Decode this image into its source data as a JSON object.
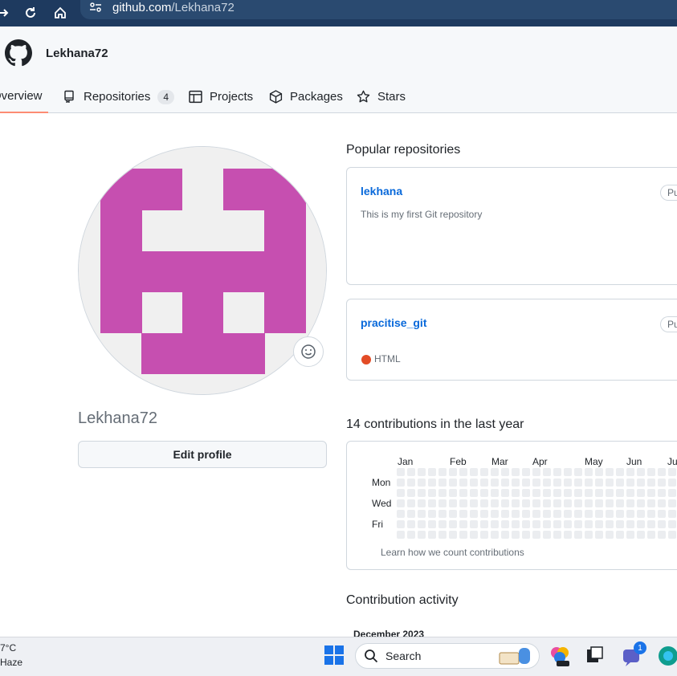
{
  "browser": {
    "url_host": "github.com",
    "url_path": "/Lekhana72"
  },
  "header": {
    "username": "Lekhana72",
    "tabs": [
      {
        "label": "Overview"
      },
      {
        "label": "Repositories",
        "count": "4"
      },
      {
        "label": "Projects"
      },
      {
        "label": "Packages"
      },
      {
        "label": "Stars"
      }
    ]
  },
  "profile": {
    "login": "Lekhana72",
    "edit_label": "Edit profile"
  },
  "popular": {
    "title": "Popular repositories",
    "repos": [
      {
        "name": "lekhana",
        "description": "This is my first Git repository",
        "visibility": "Public"
      },
      {
        "name": "pracitise_git",
        "language": "HTML",
        "visibility": "Public"
      }
    ]
  },
  "contributions": {
    "title": "14 contributions in the last year",
    "months": [
      "Jan",
      "Feb",
      "Mar",
      "Apr",
      "May",
      "Jun",
      "Jul"
    ],
    "days": [
      "Mon",
      "Wed",
      "Fri"
    ],
    "learn_link": "Learn how we count contributions"
  },
  "activity": {
    "title": "Contribution activity",
    "month_header": "December 2023"
  },
  "taskbar": {
    "temperature": "7°C",
    "condition": "Haze",
    "search_label": "Search",
    "notification_count": "1"
  },
  "colors": {
    "accent_blue": "#0969da",
    "tab_underline": "#fd8c73",
    "avatar_magenta": "#c64fb0",
    "html_lang": "#e34c26"
  }
}
